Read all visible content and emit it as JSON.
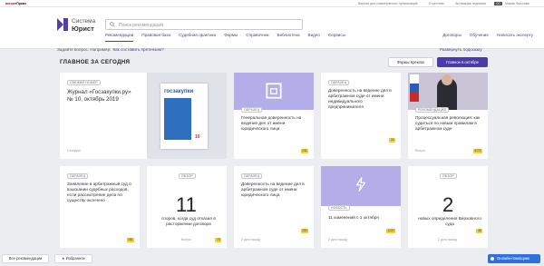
{
  "topbar": {
    "brand_red": "актион",
    "brand_black": "Право",
    "links": [
      "Версия для коммерческих организаций",
      "О системе",
      "Активация подписки"
    ],
    "user_badge": "ОО",
    "user_name": "Мария Фролова"
  },
  "logo": {
    "line1": "Система",
    "line2": "Юрист"
  },
  "search": {
    "placeholder": "Поиск рекомендаций"
  },
  "nav": {
    "items": [
      "Рекомендации",
      "Правовая база",
      "Судебная практика",
      "Формы",
      "Справочник",
      "Библиотека",
      "Видео",
      "Сервисы"
    ],
    "right": [
      "Договоры",
      "Обучение",
      "Написать эксперту"
    ]
  },
  "ask": {
    "question": "Задайте вопрос. Например:",
    "example": "Как составить претензию?",
    "expand": "Развернуть подсказку"
  },
  "section": {
    "title": "ГЛАВНОЕ ЗА СЕГОДНЯ",
    "btn_kremlin": "Формы Кремлю",
    "btn_october": "Главное в октябре"
  },
  "cards": {
    "c1": {
      "pill": "СВЕЖИЙ НОМЕР",
      "title": "Журнал «Госзакупки.ру» № 10, октябрь 2019",
      "date": "Сегодня",
      "cover_text": "госзакупки",
      "cover_num": "10"
    },
    "c2": {
      "pill": "ОБРАЗЕЦ",
      "text": "Генеральная доверенность на ведение дел от имени юридического лица",
      "tag": "241"
    },
    "c3": {
      "pill": "ОБРАЗЕЦ",
      "text": "Доверенность на ведение дел в арбитражном суде от имени индивидуального предпринимателя",
      "tag": "24"
    },
    "c4": {
      "pill": "РЕКОМЕНДАЦИЯ",
      "text": "Процессуальная революция: как судиться по новым правилам в арбитражном суде",
      "date": "Вчера",
      "tag": "4774"
    },
    "c5": {
      "pill": "ОБРАЗЕЦ",
      "text": "Заявление в арбитражный суд о взыскании судебных расходов, если рассмотрение дела по существу окончено",
      "tag": "181"
    },
    "c6": {
      "pill": "ОБЗОР",
      "number": "11",
      "text": "споров, когда суд отказал в расторжении договора",
      "date": "Вчера",
      "tag": "73"
    },
    "c7": {
      "pill": "ОБРАЗЕЦ",
      "text": "Доверенность на ведение дел в арбитражном суде от имени юридического лица",
      "date": "2 дня назад",
      "tag": "253"
    },
    "c8": {
      "pill": "НОВОСТЬ",
      "text": "11 изменений с 1 октября",
      "date": "2 дня назад",
      "tag": "1220"
    },
    "c9": {
      "pill": "ОБЗОР",
      "number": "2",
      "text": "новых определения Верховного суда",
      "date": "2 дня назад",
      "tag": "48"
    }
  },
  "bottom": {
    "all_recs": "Все рекомендации",
    "favorites": "Избранное",
    "consult": "Онлайн-помощник"
  },
  "colors": {
    "accent": "#4b3aa9",
    "lavender": "#b4aee8",
    "tag_yellow": "#f7cd46",
    "consult_blue": "#2f6fe0"
  }
}
